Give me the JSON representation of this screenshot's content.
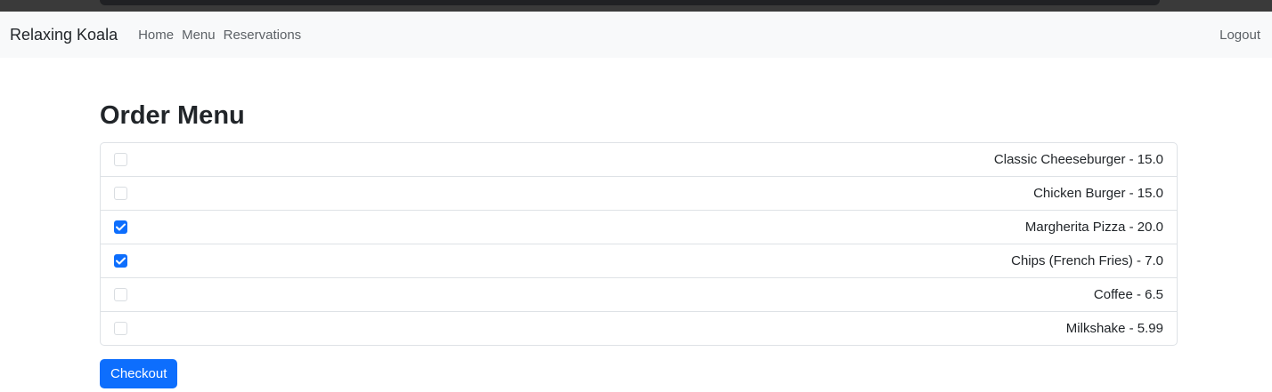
{
  "navbar": {
    "brand": "Relaxing Koala",
    "links": [
      "Home",
      "Menu",
      "Reservations"
    ],
    "logout": "Logout"
  },
  "page": {
    "title": "Order Menu",
    "items": [
      {
        "label": "Classic Cheeseburger - 15.0",
        "checked": false
      },
      {
        "label": "Chicken Burger - 15.0",
        "checked": false
      },
      {
        "label": "Margherita Pizza - 20.0",
        "checked": true
      },
      {
        "label": "Chips (French Fries) - 7.0",
        "checked": true
      },
      {
        "label": "Coffee - 6.5",
        "checked": false
      },
      {
        "label": "Milkshake - 5.99",
        "checked": false
      }
    ],
    "checkout_label": "Checkout"
  },
  "colors": {
    "accent": "#0d6efd",
    "navbar_bg": "#f8f9fa"
  }
}
